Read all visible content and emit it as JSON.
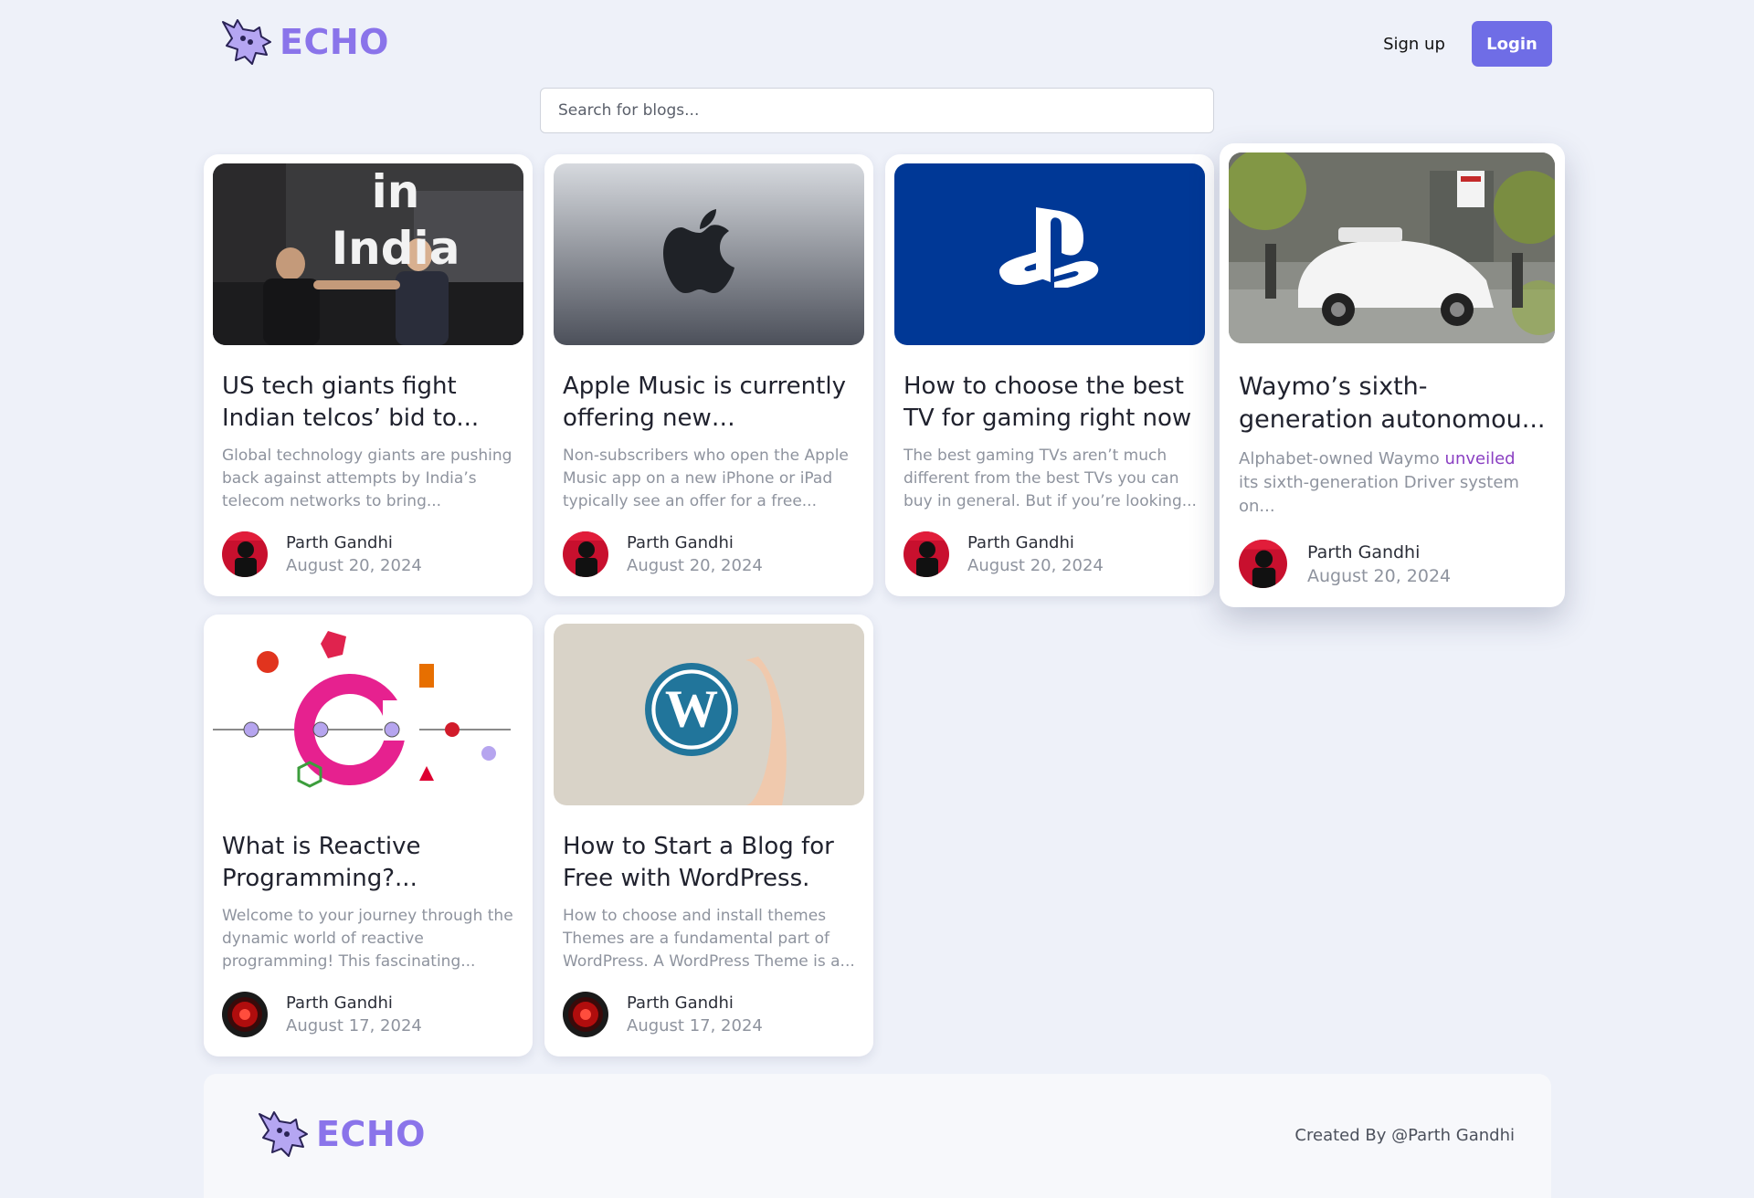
{
  "brand": {
    "name": "ECHO"
  },
  "header": {
    "signup_label": "Sign up",
    "login_label": "Login"
  },
  "search": {
    "placeholder": "Search for blogs..."
  },
  "posts": [
    {
      "title": "US tech giants fight Indian telcos’ bid to...",
      "excerpt": "Global technology giants are pushing back against attempts by India’s telecom networks to bring...",
      "author": "Parth Gandhi",
      "date": "August 20, 2024",
      "image_caption": "in India"
    },
    {
      "title": "Apple Music is currently offering new subscriber...",
      "excerpt": "Non-subscribers who open the Apple Music app on a new iPhone or iPad typically see an offer for a free...",
      "author": "Parth Gandhi",
      "date": "August 20, 2024"
    },
    {
      "title": "How to choose the best TV for gaming right now",
      "excerpt": "The best gaming TVs aren’t much different from the best TVs you can buy in general. But if you’re looking...",
      "author": "Parth Gandhi",
      "date": "August 20, 2024"
    },
    {
      "title": "Waymo’s sixth-generation autonomou...",
      "excerpt_before": "Alphabet-owned Waymo ",
      "excerpt_link": "unveiled",
      "excerpt_after": " its sixth-generation Driver system on...",
      "author": "Parth Gandhi",
      "date": "August 20, 2024"
    },
    {
      "title": "What is Reactive Programming?...",
      "excerpt": "Welcome to your journey through the dynamic world of reactive programming! This fascinating...",
      "author": "Parth Gandhi",
      "date": "August 17, 2024"
    },
    {
      "title": "How to Start a Blog for Free with WordPress.",
      "excerpt": "How to choose and install themes Themes are a fundamental part of WordPress. A WordPress Theme is a...",
      "author": "Parth Gandhi",
      "date": "August 17, 2024"
    }
  ],
  "footer": {
    "credit": "Created By @Parth Gandhi"
  },
  "icons": [
    "bat-logo-icon",
    "apple-logo-icon",
    "playstation-logo-icon",
    "wordpress-logo-icon",
    "avatar-image"
  ],
  "colors": {
    "accent": "#6f6de6",
    "brand": "#8a74ea",
    "background": "#eef1f9",
    "link": "#8a3fc2"
  }
}
